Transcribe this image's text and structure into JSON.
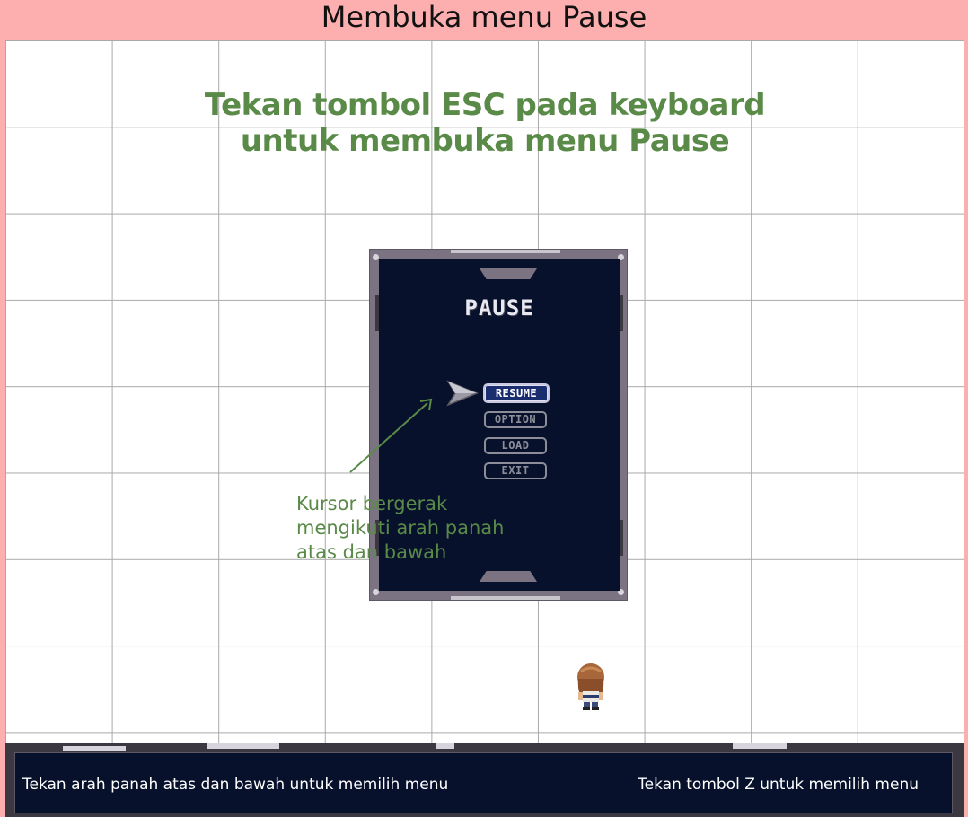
{
  "frame": {
    "title": "Membuka menu Pause"
  },
  "instruction": {
    "line1": "Tekan tombol ESC pada keyboard",
    "line2": "untuk membuka menu Pause"
  },
  "pause_menu": {
    "title": "PAUSE",
    "items": [
      {
        "label": "RESUME",
        "selected": true
      },
      {
        "label": "OPTION",
        "selected": false
      },
      {
        "label": "LOAD",
        "selected": false
      },
      {
        "label": "EXIT",
        "selected": false
      }
    ]
  },
  "annotation": {
    "caption": "Kursor bergerak\nmengikuti arah panah\natas dan bawah"
  },
  "hud": {
    "left_hint": "Tekan arah panah atas dan bawah untuk memilih menu",
    "right_hint": "Tekan tombol Z untuk memilih menu"
  },
  "colors": {
    "frame_bg": "#fdaeae",
    "accent_green": "#5a8a48",
    "panel_navy": "#07112c",
    "panel_border": "#7b7382"
  },
  "icons": {
    "cursor": "arrow-cursor-icon",
    "player": "player-character-sprite"
  }
}
